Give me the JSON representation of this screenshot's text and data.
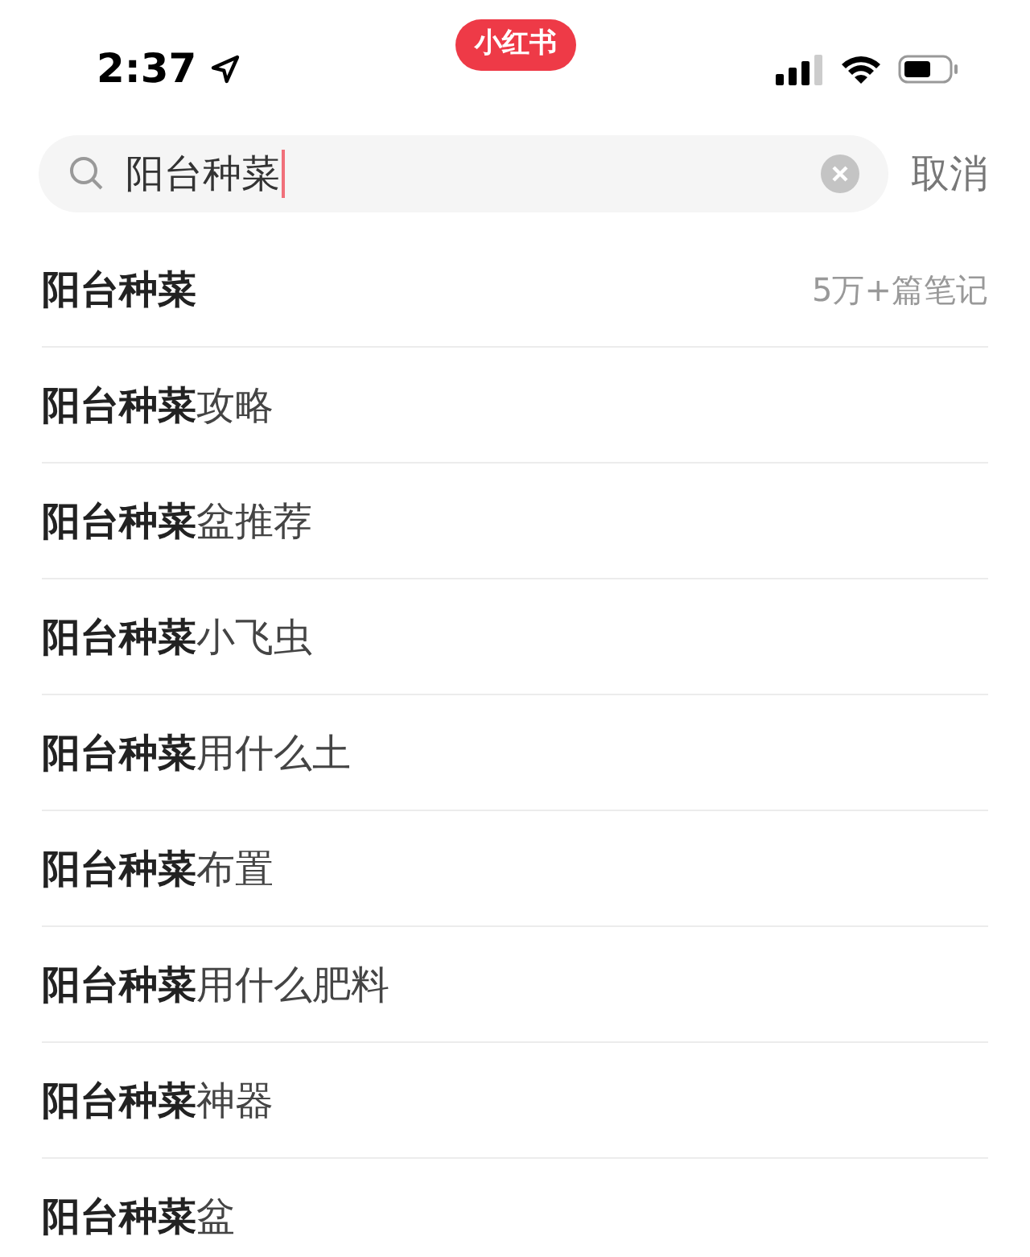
{
  "status_bar": {
    "time": "2:37",
    "app_badge": "小红书"
  },
  "search": {
    "value": "阳台种菜",
    "cancel": "取消"
  },
  "suggestions": [
    {
      "kind": "top",
      "text": "阳台种菜",
      "count": "5万+篇笔记"
    },
    {
      "kind": "plain",
      "text": "**阳台种菜**攻略"
    },
    {
      "kind": "plain",
      "text": "**阳台种菜**盆推荐"
    },
    {
      "kind": "plain",
      "text": "**阳台种菜**小飞虫"
    },
    {
      "kind": "plain",
      "text": "**阳台种菜**用什么土"
    },
    {
      "kind": "plain",
      "text": "**阳台种菜**布置"
    },
    {
      "kind": "plain",
      "text": "**阳台种菜**用什么肥料"
    },
    {
      "kind": "plain",
      "text": "**阳台种菜**神器"
    },
    {
      "kind": "plain",
      "text": "**阳台种菜**盆"
    }
  ]
}
